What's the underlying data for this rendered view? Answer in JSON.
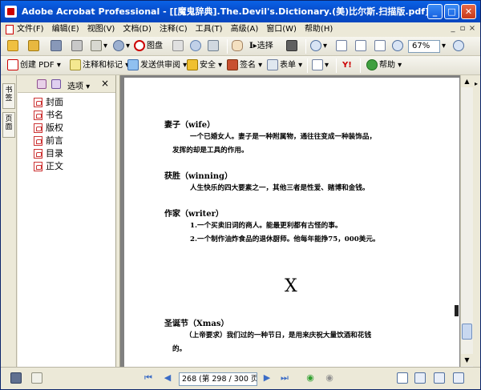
{
  "window": {
    "title": "Adobe Acrobat Professional - [[魔鬼辞典].The.Devil's.Dictionary.(美)比尔斯.扫描版.pdf]",
    "min_label": "_",
    "max_label": "□",
    "close_label": "✕"
  },
  "menu": {
    "items": [
      "文件(F)",
      "编辑(E)",
      "视图(V)",
      "文档(D)",
      "注释(C)",
      "工具(T)",
      "高级(A)",
      "窗口(W)",
      "帮助(H)"
    ],
    "mdi_buttons": [
      "_",
      "▫",
      "×"
    ]
  },
  "toolbar1": {
    "select_label": "选择",
    "zoom_value": "67%"
  },
  "toolbar2": {
    "create_pdf": "创建 PDF",
    "comment_markup": "注释和标记",
    "send_review": "发送供审阅",
    "security": "安全",
    "sign": "签名",
    "forms": "表单",
    "help": "帮助"
  },
  "sidebar": {
    "tab_bookmarks": "书签",
    "tab_pages": "页面",
    "options_label": "选项",
    "close_label": "×",
    "bookmarks": [
      "封面",
      "书名",
      "版权",
      "前言",
      "目录",
      "正文"
    ]
  },
  "document": {
    "entries": [
      {
        "title": "妻子（wife）",
        "lines": [
          "一个已婚女人。妻子是一种附属物，通往往变成一种装饰品，",
          "发挥的却是工具的作用。"
        ]
      },
      {
        "title": "获胜（winning）",
        "lines": [
          "人生快乐的四大要素之一，其他三者是性爱、赌博和金钱。"
        ]
      },
      {
        "title": "作家（writer）",
        "lines": [
          "1.一个买卖旧词的商人。能最更利都有古怪的事。",
          "2.一个制作油炸食品的退休厨师。他每年能挣75，000美元。"
        ]
      }
    ],
    "section_letter": "X",
    "entries2": [
      {
        "title": "圣诞节（Xmas）",
        "lines": [
          "（上帝要求）我们过的一种节日，是用来庆祝大量饮酒和花钱",
          "的。"
        ]
      }
    ]
  },
  "status": {
    "page_display": "268 (第 298 / 300 页)"
  }
}
